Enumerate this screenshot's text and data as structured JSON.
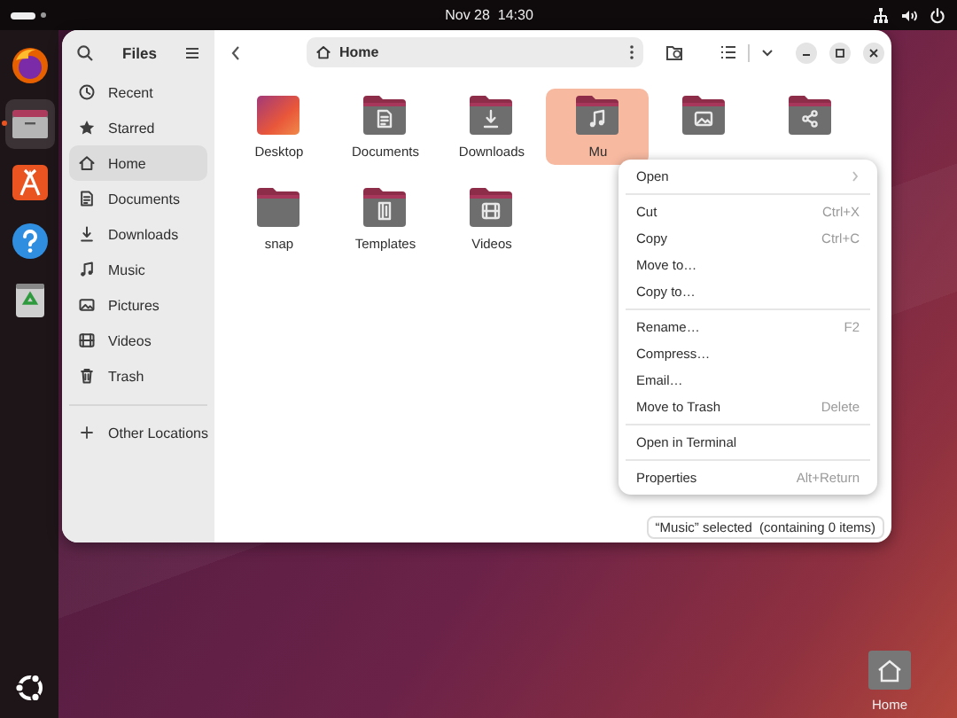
{
  "top_bar": {
    "clock": "Nov 28  14:30"
  },
  "dock": {
    "items": [
      {
        "kind": "firefox",
        "selected": false
      },
      {
        "kind": "files",
        "selected": true
      },
      {
        "kind": "app-center",
        "selected": false
      },
      {
        "kind": "help",
        "selected": false
      },
      {
        "kind": "trash",
        "selected": false
      }
    ]
  },
  "window": {
    "title": "Files",
    "sidebar": {
      "items": [
        {
          "kind": "recent",
          "label": "Recent",
          "selected": false
        },
        {
          "kind": "star",
          "label": "Starred",
          "selected": false
        },
        {
          "kind": "home",
          "label": "Home",
          "selected": true
        },
        {
          "kind": "document",
          "label": "Documents",
          "selected": false
        },
        {
          "kind": "download",
          "label": "Downloads",
          "selected": false
        },
        {
          "kind": "music",
          "label": "Music",
          "selected": false
        },
        {
          "kind": "picture",
          "label": "Pictures",
          "selected": false
        },
        {
          "kind": "video",
          "label": "Videos",
          "selected": false
        },
        {
          "kind": "trash",
          "label": "Trash",
          "selected": false
        }
      ],
      "other_locations": "Other Locations"
    },
    "path": "Home",
    "folders": [
      {
        "kind": "desktop",
        "name": "Desktop",
        "selected": false
      },
      {
        "kind": "document",
        "name": "Documents",
        "selected": false
      },
      {
        "kind": "download",
        "name": "Downloads",
        "selected": false
      },
      {
        "kind": "music",
        "name": "Mu",
        "selected": true
      },
      {
        "kind": "picture",
        "selected": false
      },
      {
        "kind": "share",
        "selected": false
      },
      {
        "kind": "plain",
        "name": "snap",
        "selected": false
      },
      {
        "kind": "template",
        "name": "Templates",
        "selected": false
      },
      {
        "kind": "video",
        "name": "Videos",
        "selected": false
      }
    ],
    "status": "“Music” selected  (containing 0 items)"
  },
  "context_menu": {
    "sections": [
      [
        {
          "label": "Open",
          "submenu": true
        }
      ],
      [
        {
          "label": "Cut",
          "shortcut": "Ctrl+X"
        },
        {
          "label": "Copy",
          "shortcut": "Ctrl+C"
        },
        {
          "label": "Move to…"
        },
        {
          "label": "Copy to…"
        }
      ],
      [
        {
          "label": "Rename…",
          "shortcut": "F2"
        },
        {
          "label": "Compress…"
        },
        {
          "label": "Email…"
        },
        {
          "label": "Move to Trash",
          "shortcut": "Delete"
        }
      ],
      [
        {
          "label": "Open in Terminal"
        }
      ],
      [
        {
          "label": "Properties",
          "shortcut": "Alt+Return"
        }
      ]
    ]
  },
  "desktop_icons": [
    {
      "label": "Home"
    }
  ]
}
